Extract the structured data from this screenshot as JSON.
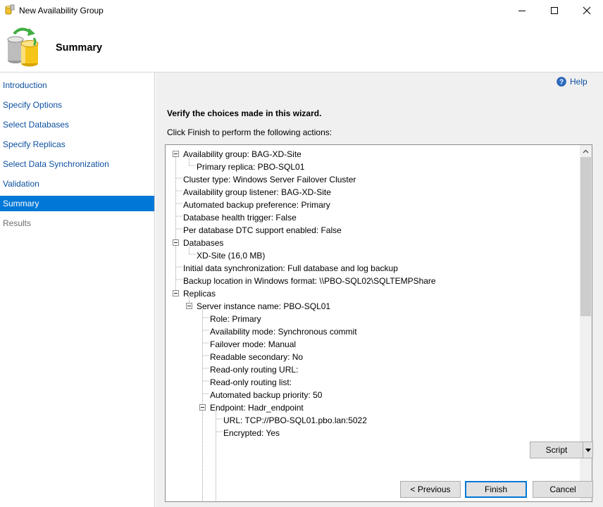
{
  "window": {
    "title": "New Availability Group"
  },
  "header": {
    "title": "Summary"
  },
  "sidebar": {
    "items": [
      {
        "label": "Introduction",
        "state": "link"
      },
      {
        "label": "Specify Options",
        "state": "link"
      },
      {
        "label": "Select Databases",
        "state": "link"
      },
      {
        "label": "Specify Replicas",
        "state": "link"
      },
      {
        "label": "Select Data Synchronization",
        "state": "link"
      },
      {
        "label": "Validation",
        "state": "link"
      },
      {
        "label": "Summary",
        "state": "active"
      },
      {
        "label": "Results",
        "state": "disabled"
      }
    ]
  },
  "main": {
    "help_label": "Help",
    "verify_text": "Verify the choices made in this wizard.",
    "instruction_text": "Click Finish to perform the following actions:",
    "tree": [
      {
        "text": "Availability group: BAG-XD-Site",
        "level": 0,
        "expander": true
      },
      {
        "text": "Primary replica: PBO-SQL01",
        "level": 1,
        "expander": false
      },
      {
        "text": "Cluster type: Windows Server Failover Cluster",
        "level": 0,
        "expander": false
      },
      {
        "text": "Availability group listener: BAG-XD-Site",
        "level": 0,
        "expander": false
      },
      {
        "text": "Automated backup preference: Primary",
        "level": 0,
        "expander": false
      },
      {
        "text": "Database health trigger: False",
        "level": 0,
        "expander": false
      },
      {
        "text": "Per database DTC support enabled: False",
        "level": 0,
        "expander": false
      },
      {
        "text": "Databases",
        "level": 0,
        "expander": true
      },
      {
        "text": "XD-Site (16,0 MB)",
        "level": 1,
        "expander": false
      },
      {
        "text": "Initial data synchronization: Full database and log backup",
        "level": 0,
        "expander": false
      },
      {
        "text": "Backup location in Windows format: \\\\PBO-SQL02\\SQLTEMPShare",
        "level": 0,
        "expander": false
      },
      {
        "text": "Replicas",
        "level": 0,
        "expander": true
      },
      {
        "text": "Server instance name: PBO-SQL01",
        "level": 1,
        "expander": true
      },
      {
        "text": "Role: Primary",
        "level": 2,
        "expander": false
      },
      {
        "text": "Availability mode: Synchronous commit",
        "level": 2,
        "expander": false
      },
      {
        "text": "Failover mode: Manual",
        "level": 2,
        "expander": false
      },
      {
        "text": "Readable secondary: No",
        "level": 2,
        "expander": false
      },
      {
        "text": "Read-only routing URL:",
        "level": 2,
        "expander": false
      },
      {
        "text": "Read-only routing list:",
        "level": 2,
        "expander": false
      },
      {
        "text": "Automated backup priority: 50",
        "level": 2,
        "expander": false
      },
      {
        "text": "Endpoint: Hadr_endpoint",
        "level": 2,
        "expander": true
      },
      {
        "text": "URL: TCP://PBO-SQL01.pbo.lan:5022",
        "level": 3,
        "expander": false
      },
      {
        "text": "Encrypted: Yes",
        "level": 3,
        "expander": false
      }
    ]
  },
  "buttons": {
    "script": "Script",
    "previous": "< Previous",
    "finish": "Finish",
    "cancel": "Cancel"
  },
  "colors": {
    "accent": "#0078d7",
    "link": "#0b4f9e",
    "panel": "#f0f0f0"
  }
}
